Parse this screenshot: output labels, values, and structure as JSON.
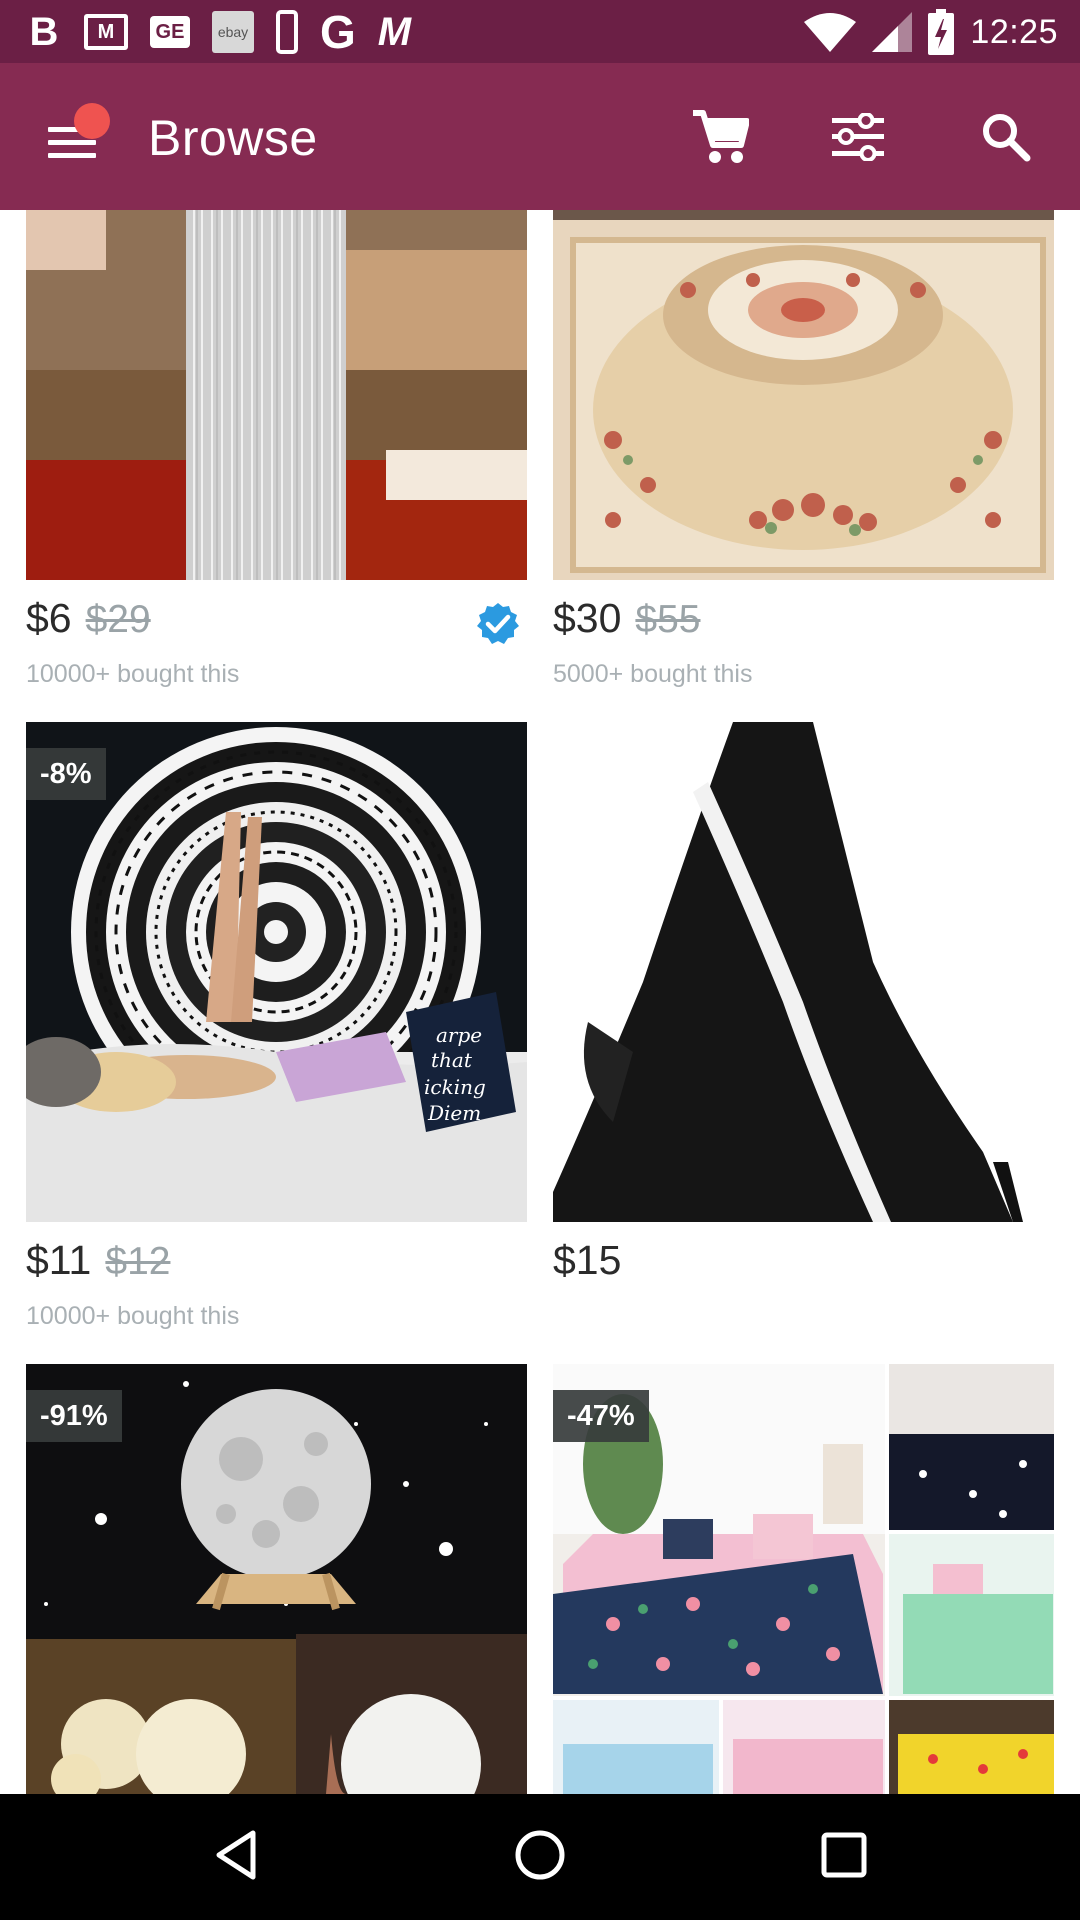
{
  "status_bar": {
    "time": "12:25",
    "left_icons": [
      "b-app-icon",
      "gmail-icon",
      "ge-app-icon",
      "ebay-icon",
      "phone-icon",
      "g-app-icon",
      "m-app-icon"
    ],
    "ebay_text": "ebay",
    "ge_text": "GE",
    "b_text": "B",
    "g_text": "G",
    "m_text": "M",
    "mail_text": "M"
  },
  "app_bar": {
    "title": "Browse",
    "color": "#862b52",
    "status_color": "#6b1f45",
    "notification_dot_color": "#ef5350"
  },
  "products": [
    {
      "image": "silver-string-curtain",
      "price": "$6",
      "old_price": "$29",
      "bought": "10000+ bought this",
      "verified": true,
      "discount": ""
    },
    {
      "image": "floral-area-rug",
      "price": "$30",
      "old_price": "$55",
      "bought": "5000+ bought this",
      "verified": false,
      "discount": ""
    },
    {
      "image": "mandala-tapestry-bedroom",
      "price": "$11",
      "old_price": "$12",
      "bought": "10000+ bought this",
      "verified": false,
      "discount": "-8%"
    },
    {
      "image": "black-sling-bag",
      "price": "$15",
      "old_price": "",
      "bought": "",
      "verified": false,
      "discount": ""
    },
    {
      "image": "moon-lamp",
      "price": "",
      "old_price": "",
      "bought": "",
      "verified": false,
      "discount": "-91%"
    },
    {
      "image": "flamingo-bedding-set",
      "price": "",
      "old_price": "",
      "bought": "",
      "verified": false,
      "discount": "-47%"
    }
  ],
  "nav_bar": {
    "buttons": [
      "back-icon",
      "home-icon",
      "recents-icon"
    ]
  }
}
